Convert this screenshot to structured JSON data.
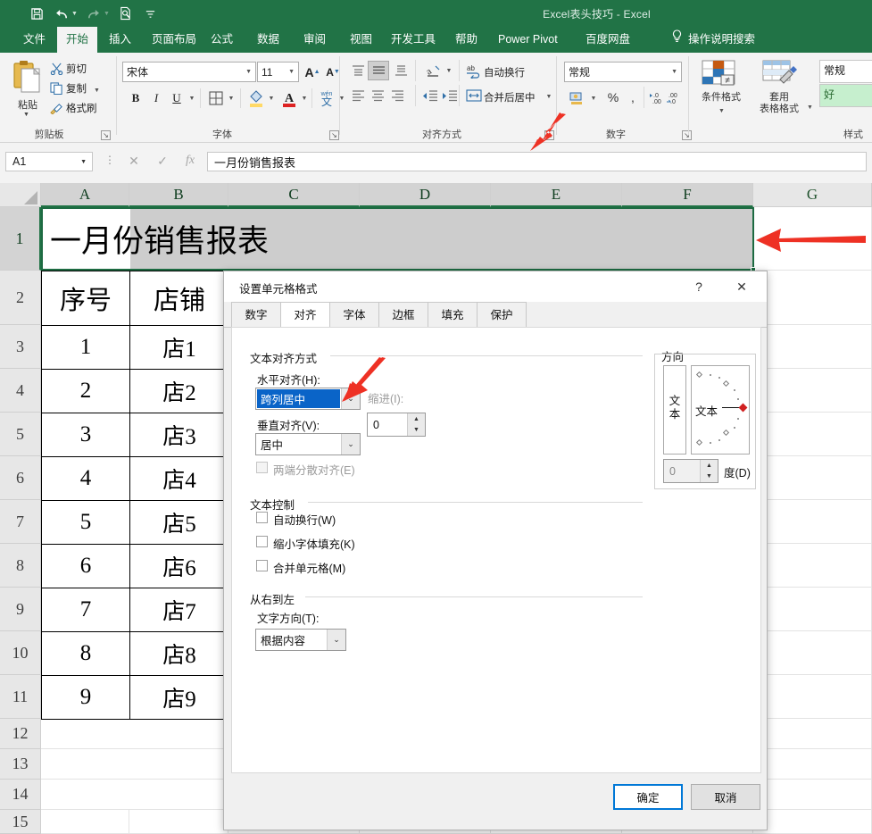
{
  "titlebar": {
    "document_title": "Excel表头技巧  -  Excel",
    "qat": [
      {
        "name": "save-icon",
        "glyph": "💾"
      },
      {
        "name": "undo-icon",
        "glyph": "↶"
      },
      {
        "name": "redo-icon",
        "glyph": "↷"
      },
      {
        "name": "print-preview-icon",
        "glyph": "🔍"
      },
      {
        "name": "customize-qat-icon",
        "glyph": "∇"
      }
    ]
  },
  "ribbon_tabs": [
    {
      "label": "文件",
      "active": false
    },
    {
      "label": "开始",
      "active": true
    },
    {
      "label": "插入",
      "active": false
    },
    {
      "label": "页面布局",
      "active": false
    },
    {
      "label": "公式",
      "active": false
    },
    {
      "label": "数据",
      "active": false
    },
    {
      "label": "审阅",
      "active": false
    },
    {
      "label": "视图",
      "active": false
    },
    {
      "label": "开发工具",
      "active": false
    },
    {
      "label": "帮助",
      "active": false
    },
    {
      "label": "Power Pivot",
      "active": false
    },
    {
      "label": "百度网盘",
      "active": false
    }
  ],
  "search": {
    "label": "操作说明搜索"
  },
  "ribbon": {
    "clipboard": {
      "group_label": "剪贴板",
      "paste_label": "粘贴",
      "cut_label": "剪切",
      "copy_label": "复制",
      "format_painter_label": "格式刷"
    },
    "font": {
      "group_label": "字体",
      "font_name": "宋体",
      "font_size": "11",
      "grow_label": "A",
      "shrink_label": "A",
      "bold_label": "B",
      "italic_label": "I",
      "underline_label": "U",
      "border_icon": "borders-icon",
      "fill_icon": "fill-color-icon",
      "font_color_icon": "font-color-icon",
      "phonetic_label": "文"
    },
    "alignment": {
      "group_label": "对齐方式",
      "wrap_text_label": "自动换行",
      "merge_center_label": "合并后居中",
      "orientation_icon": "orientation-icon",
      "decrease_indent_icon": "decrease-indent-icon",
      "increase_indent_icon": "increase-indent-icon"
    },
    "number": {
      "group_label": "数字",
      "format": "常规",
      "percent_label": "%",
      "comma_label": ",",
      "increase_decimal_label": ".00",
      "decrease_decimal_label": ".00"
    },
    "styles": {
      "group_label": "样式",
      "conditional_label": "条件格式",
      "table_style_label": "套用\n表格格式",
      "cell_style_normal": "常规",
      "cell_style_good": "好"
    }
  },
  "formula_bar": {
    "name_box": "A1",
    "cancel_icon": "cancel-icon",
    "confirm_icon": "confirm-icon",
    "fx_label": "fx",
    "formula_value": "一月份销售报表"
  },
  "sheet": {
    "columns": [
      "A",
      "B",
      "C",
      "D",
      "E",
      "F",
      "G"
    ],
    "rows": [
      "1",
      "2",
      "3",
      "4",
      "5",
      "6",
      "7",
      "8",
      "9",
      "10",
      "11",
      "12",
      "13",
      "14",
      "15"
    ],
    "selected_columns": [
      "A",
      "B",
      "C",
      "D",
      "E",
      "F"
    ],
    "selected_row": "1",
    "title_cell": "一月份销售报表",
    "header_row": [
      "序号",
      "店铺"
    ],
    "data_rows": [
      [
        "1",
        "店1"
      ],
      [
        "2",
        "店2"
      ],
      [
        "3",
        "店3"
      ],
      [
        "4",
        "店4"
      ],
      [
        "5",
        "店5"
      ],
      [
        "6",
        "店6"
      ],
      [
        "7",
        "店7"
      ],
      [
        "8",
        "店8"
      ],
      [
        "9",
        "店9"
      ]
    ]
  },
  "dialog": {
    "title": "设置单元格格式",
    "help_icon": "?",
    "close_icon": "✕",
    "tabs": [
      {
        "label": "数字",
        "active": false
      },
      {
        "label": "对齐",
        "active": true
      },
      {
        "label": "字体",
        "active": false
      },
      {
        "label": "边框",
        "active": false
      },
      {
        "label": "填充",
        "active": false
      },
      {
        "label": "保护",
        "active": false
      }
    ],
    "text_alignment": {
      "legend": "文本对齐方式",
      "horizontal_label": "水平对齐(H):",
      "horizontal_value": "跨列居中",
      "vertical_label": "垂直对齐(V):",
      "vertical_value": "居中",
      "justify_distributed_label": "两端分散对齐(E)",
      "indent_label": "缩进(I):",
      "indent_value": "0"
    },
    "text_control": {
      "legend": "文本控制",
      "wrap_label": "自动换行(W)",
      "shrink_label": "缩小字体填充(K)",
      "merge_label": "合并单元格(M)"
    },
    "rtl": {
      "legend": "从右到左",
      "direction_label": "文字方向(T):",
      "direction_value": "根据内容"
    },
    "orientation": {
      "legend": "方向",
      "vertical_sample": "文本",
      "sample": "文本",
      "degrees_value": "0",
      "degrees_label": "度(D)"
    },
    "ok_label": "确定",
    "cancel_label": "取消"
  },
  "colors": {
    "excel_green": "#217346",
    "selection_green": "#1d6b42",
    "dialog_blue": "#0a64c8",
    "default_button_blue": "#0078d7",
    "arrow_red": "#ee3124",
    "good_style_bg": "#c6efce",
    "good_style_fg": "#2b6b33"
  }
}
